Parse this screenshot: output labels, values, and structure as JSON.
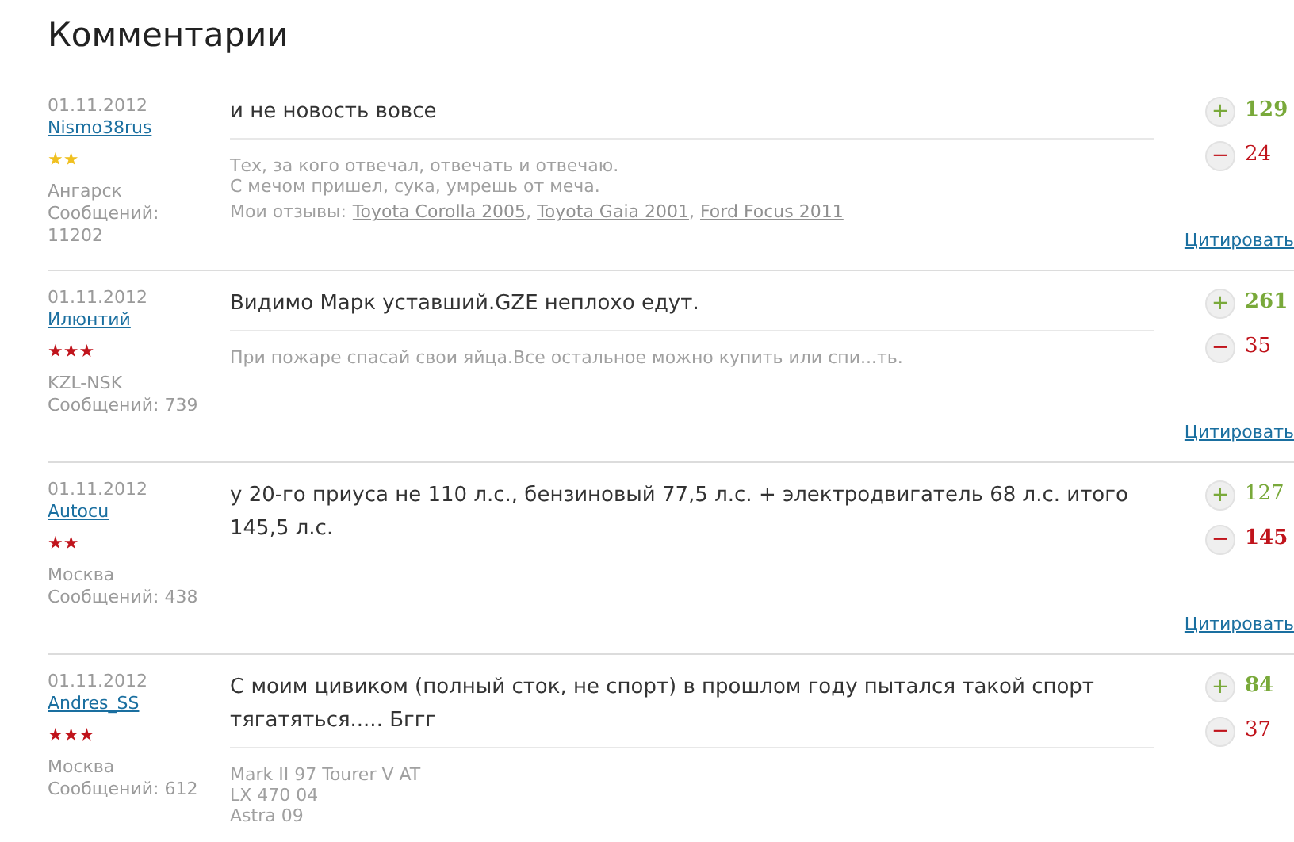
{
  "title": "Комментарии",
  "comments": [
    {
      "date": "01.11.2012",
      "author": "Nismo38rus",
      "rank": "★★",
      "color": "#f0c020",
      "city": "Ангарск",
      "posts": "Сообщений: 11202",
      "text": "и не новость вовсе",
      "signature": [
        "Тех, за кого отвечал, отвечать и отвечаю.",
        "С мечом пришел, сука, умрешь от меча."
      ],
      "reviews": {
        "label": "Мои отзывы:",
        "separator": ", ",
        "links": [
          "Toyota Corolla 2005",
          "Toyota Gaia 2001",
          "Ford Focus 2011"
        ]
      },
      "plus": {
        "sign": "+",
        "count": "129",
        "winning": true
      },
      "minus": {
        "sign": "−",
        "count": "24",
        "winning": false
      },
      "quote": "Цитировать"
    },
    {
      "date": "01.11.2012",
      "author": "Илюнтий",
      "rank": "★★★",
      "color": "#c0141c",
      "city": "KZL-NSK",
      "posts": "Сообщений: 739",
      "text": "Видимо Марк уставший.GZE неплохо едут.",
      "signature": [
        "При пожаре спасай свои яйца.Все остальное можно купить или спи...ть."
      ],
      "plus": {
        "sign": "+",
        "count": "261",
        "winning": true
      },
      "minus": {
        "sign": "−",
        "count": "35",
        "winning": false
      },
      "quote": "Цитировать"
    },
    {
      "date": "01.11.2012",
      "author": "Autocu",
      "rank": "★★",
      "color": "#c0141c",
      "city": "Москва",
      "posts": "Сообщений: 438",
      "text": "у 20-го приуса не 110 л.с., бензиновый 77,5 л.с. + электродвигатель 68 л.с. итого 145,5 л.с.",
      "plus": {
        "sign": "+",
        "count": "127",
        "winning": false
      },
      "minus": {
        "sign": "−",
        "count": "145",
        "winning": true
      },
      "quote": "Цитировать"
    },
    {
      "date": "01.11.2012",
      "author": "Andres_SS",
      "rank": "★★★",
      "color": "#c0141c",
      "city": "Москва",
      "posts": "Сообщений: 612",
      "text": "С моим цивиком (полный сток, не спорт) в прошлом году пытался такой спорт тягатяться..... Бггг",
      "signature": [
        "Mark II 97 Tourer V AT",
        "LX 470 04",
        "Astra 09"
      ],
      "plus": {
        "sign": "+",
        "count": "84",
        "winning": true
      },
      "minus": {
        "sign": "−",
        "count": "37",
        "winning": false
      }
    }
  ]
}
